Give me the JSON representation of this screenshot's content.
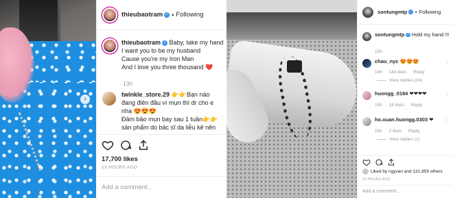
{
  "left_post": {
    "author": {
      "username": "thieubaotram",
      "follow_status": "Following",
      "separator": "•"
    },
    "caption": {
      "username": "thieubaotram",
      "lines": [
        "Baby, take my hand",
        "I want you to be my husband",
        "Cause you're my Iron Man",
        "And I love you three thousand ❤️"
      ],
      "time": "13h"
    },
    "comment": {
      "username": "twinkle_store.29",
      "lines": [
        "👉👉Bạn nào",
        "đang điên đầu vì mụn thì dr cho e",
        "nha 😍😍😍",
        "Đảm bảo mụn bay sau 1 tuần👉👉",
        "sản phẩm do bác sĩ da liễu kê nên"
      ]
    },
    "likes": "17,700 likes",
    "timestamp": "13 HOURS AGO",
    "add_comment_placeholder": "Add a comment...",
    "carousel_next": "›"
  },
  "right_post": {
    "author": {
      "username": "sontungmtp",
      "follow_status": "Following",
      "separator": "•"
    },
    "caption": {
      "username": "sontungmtp",
      "text": "Hold my hand !!!",
      "time": "15h"
    },
    "comments": [
      {
        "username": "chau_nyc",
        "text": "😍😍😍",
        "time": "14h",
        "likes": "144 likes",
        "reply": "Reply",
        "view_replies": "View replies (34)"
      },
      {
        "username": "huongg_0194",
        "text": "❤❤❤❤",
        "time": "15h",
        "likes": "18 likes",
        "reply": "Reply",
        "view_replies": ""
      },
      {
        "username": "ho.xuan.huongg.0303",
        "text": "❤",
        "time": "15h",
        "likes": "2 likes",
        "reply": "Reply",
        "view_replies": "View replies (1)"
      }
    ],
    "likes_text": "Liked by ngyvan and 131,859 others",
    "likes_names": {
      "first": "ngyvan",
      "count": "131,859 others"
    },
    "timestamp": "13 HOURS AGO",
    "add_comment_placeholder": "Add a comment..."
  },
  "icons": {
    "like": "heart-icon",
    "comment": "comment-icon",
    "share": "share-icon",
    "verified": "verified-badge-icon"
  },
  "colors": {
    "verified": "#3897f0",
    "story_ring": "#d6249f",
    "muted": "#999999",
    "border": "#efefef"
  }
}
